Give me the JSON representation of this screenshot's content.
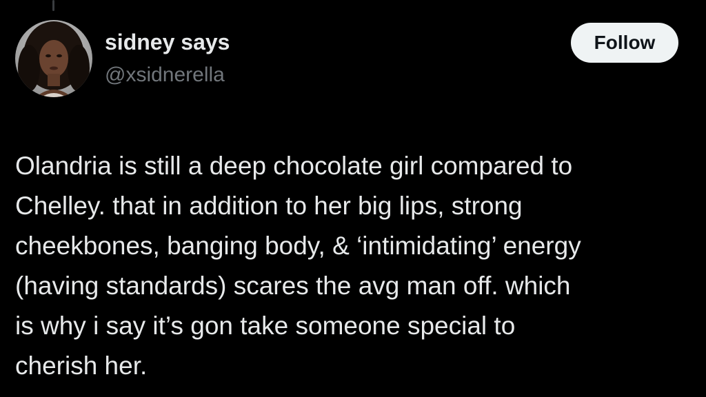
{
  "author": {
    "display_name": "sidney says",
    "handle": "@xsidnerella"
  },
  "actions": {
    "follow_label": "Follow"
  },
  "tweet": {
    "lines": [
      "Olandria is still a deep chocolate girl compared to",
      "Chelley. that in addition to her big lips, strong",
      "cheekbones, banging body, & ‘intimidating’ energy",
      "(having standards) scares the avg man off. which",
      "is why i say it’s gon take someone special to",
      "cherish her."
    ]
  },
  "colors": {
    "background": "#000000",
    "text_primary": "#e7e9ea",
    "text_secondary": "#71767b",
    "follow_button_bg": "#eff3f4",
    "follow_button_text": "#0f1419"
  }
}
